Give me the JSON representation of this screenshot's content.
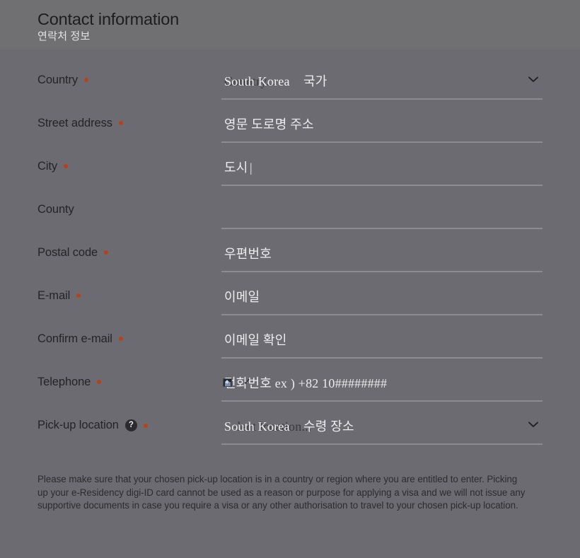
{
  "header": {
    "title": "Contact information",
    "subtitle": "연락처 정보"
  },
  "form": {
    "fields": [
      {
        "label": "Country",
        "required": true,
        "type": "select",
        "value": "South Korea",
        "placeholder": "Country...",
        "secondary_placeholder": "국가",
        "chevron": "chevron-down-icon"
      },
      {
        "label": "Street address",
        "required": true,
        "type": "text",
        "value": "",
        "placeholder": "영문 도로명 주소"
      },
      {
        "label": "City",
        "required": true,
        "type": "text",
        "value": "",
        "placeholder": "도시",
        "caret": "|"
      },
      {
        "label": "County",
        "required": false,
        "type": "text",
        "value": "",
        "placeholder": ""
      },
      {
        "label": "Postal code",
        "required": true,
        "type": "text",
        "value": "",
        "placeholder": "우편번호"
      },
      {
        "label": "E-mail",
        "required": true,
        "type": "text",
        "value": "",
        "placeholder": "이메일"
      },
      {
        "label": "Confirm e-mail",
        "required": true,
        "type": "text",
        "value": "",
        "placeholder": "이메일 확인"
      },
      {
        "label": "Telephone",
        "required": true,
        "type": "text",
        "value": "",
        "placeholder": "전화번호 ex ) +82 10########",
        "overlay_icons": [
          "broken-image-icon",
          "check-icon"
        ]
      },
      {
        "label": "Pick-up location",
        "required": true,
        "type": "select",
        "help": "?",
        "value": "South Korea",
        "placeholder": "Select location...",
        "secondary_placeholder": "수령 장소",
        "chevron": "chevron-down-icon"
      }
    ]
  },
  "disclaimer": {
    "text": "Please make sure that your chosen pick-up location is in a country or region where you are entitled to enter. Picking up your e-Residency digi-ID card cannot be used as a reason or purpose for applying a visa and we will not issue any supportive documents in case you require a visa or any other authorisation to travel to your chosen pick-up location."
  },
  "colors": {
    "background": "#6b6b71",
    "header_background": "#707073",
    "required_dot": "#b8401a",
    "underline": "#8b8b90",
    "label_text": "#242428",
    "input_text": "#ededef"
  }
}
